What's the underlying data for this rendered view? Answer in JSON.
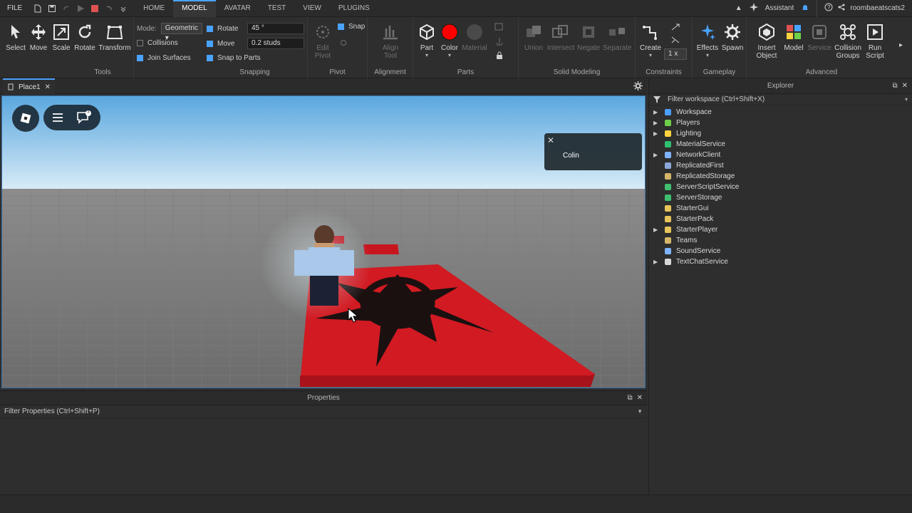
{
  "menubar": {
    "file_label": "FILE",
    "tabs": [
      "HOME",
      "MODEL",
      "AVATAR",
      "TEST",
      "VIEW",
      "PLUGINS"
    ],
    "active_tab": "MODEL",
    "assistant_label": "Assistant",
    "username": "roombaeatscats2"
  },
  "ribbon": {
    "tools": {
      "select": "Select",
      "move": "Move",
      "scale": "Scale",
      "rotate": "Rotate",
      "transform": "Transform",
      "group_label": "Tools"
    },
    "mode": {
      "label": "Mode:",
      "value": "Geometric",
      "collisions": "Collisions",
      "join_surfaces": "Join Surfaces"
    },
    "snapping": {
      "rotate_label": "Rotate",
      "rotate_value": "45 °",
      "move_label": "Move",
      "move_value": "0.2 studs",
      "snap_to_parts": "Snap to Parts",
      "group_label": "Snapping"
    },
    "pivot": {
      "edit_pivot": "Edit Pivot",
      "snap": "Snap",
      "group_label": "Pivot"
    },
    "alignment": {
      "align_tool": "Align Tool",
      "group_label": "Alignment"
    },
    "parts": {
      "part": "Part",
      "color": "Color",
      "material": "Material",
      "group_label": "Parts",
      "color_value": "#ff0000"
    },
    "solid": {
      "union": "Union",
      "intersect": "Intersect",
      "negate": "Negate",
      "separate": "Separate",
      "group_label": "Solid Modeling"
    },
    "constraints": {
      "create": "Create",
      "scale_value": "1 x",
      "group_label": "Constraints"
    },
    "gameplay": {
      "effects": "Effects",
      "spawn": "Spawn",
      "group_label": "Gameplay"
    },
    "advanced": {
      "insert_object": "Insert Object",
      "model": "Model",
      "service": "Service",
      "collision_groups": "Collision Groups",
      "run_script": "Run Script",
      "group_label": "Advanced"
    }
  },
  "document": {
    "tab_label": "Place1"
  },
  "viewport": {
    "notification_name": "Colin",
    "chat_badge": "1"
  },
  "properties": {
    "title": "Properties",
    "filter_placeholder": "Filter Properties (Ctrl+Shift+P)"
  },
  "explorer": {
    "title": "Explorer",
    "filter_placeholder": "Filter workspace (Ctrl+Shift+X)",
    "items": [
      {
        "label": "Workspace",
        "expandable": true,
        "icon": "workspace-icon",
        "color": "#4a9eff"
      },
      {
        "label": "Players",
        "expandable": true,
        "icon": "players-icon",
        "color": "#6fcf4a"
      },
      {
        "label": "Lighting",
        "expandable": true,
        "icon": "lighting-icon",
        "color": "#ffd23f"
      },
      {
        "label": "MaterialService",
        "expandable": false,
        "icon": "material-service-icon",
        "color": "#2fbf71"
      },
      {
        "label": "NetworkClient",
        "expandable": true,
        "icon": "network-client-icon",
        "color": "#7fb3ff"
      },
      {
        "label": "ReplicatedFirst",
        "expandable": false,
        "icon": "replicated-first-icon",
        "color": "#8aa8d6"
      },
      {
        "label": "ReplicatedStorage",
        "expandable": false,
        "icon": "replicated-storage-icon",
        "color": "#d6b56a"
      },
      {
        "label": "ServerScriptService",
        "expandable": false,
        "icon": "server-script-service-icon",
        "color": "#3fbf6f"
      },
      {
        "label": "ServerStorage",
        "expandable": false,
        "icon": "server-storage-icon",
        "color": "#3fbf6f"
      },
      {
        "label": "StarterGui",
        "expandable": false,
        "icon": "starter-gui-icon",
        "color": "#e6c45a"
      },
      {
        "label": "StarterPack",
        "expandable": false,
        "icon": "starter-pack-icon",
        "color": "#e6c45a"
      },
      {
        "label": "StarterPlayer",
        "expandable": true,
        "icon": "starter-player-icon",
        "color": "#e6c45a"
      },
      {
        "label": "Teams",
        "expandable": false,
        "icon": "teams-icon",
        "color": "#d6b56a"
      },
      {
        "label": "SoundService",
        "expandable": false,
        "icon": "sound-service-icon",
        "color": "#7fb3ff"
      },
      {
        "label": "TextChatService",
        "expandable": true,
        "icon": "text-chat-service-icon",
        "color": "#d8d8d8"
      }
    ]
  }
}
